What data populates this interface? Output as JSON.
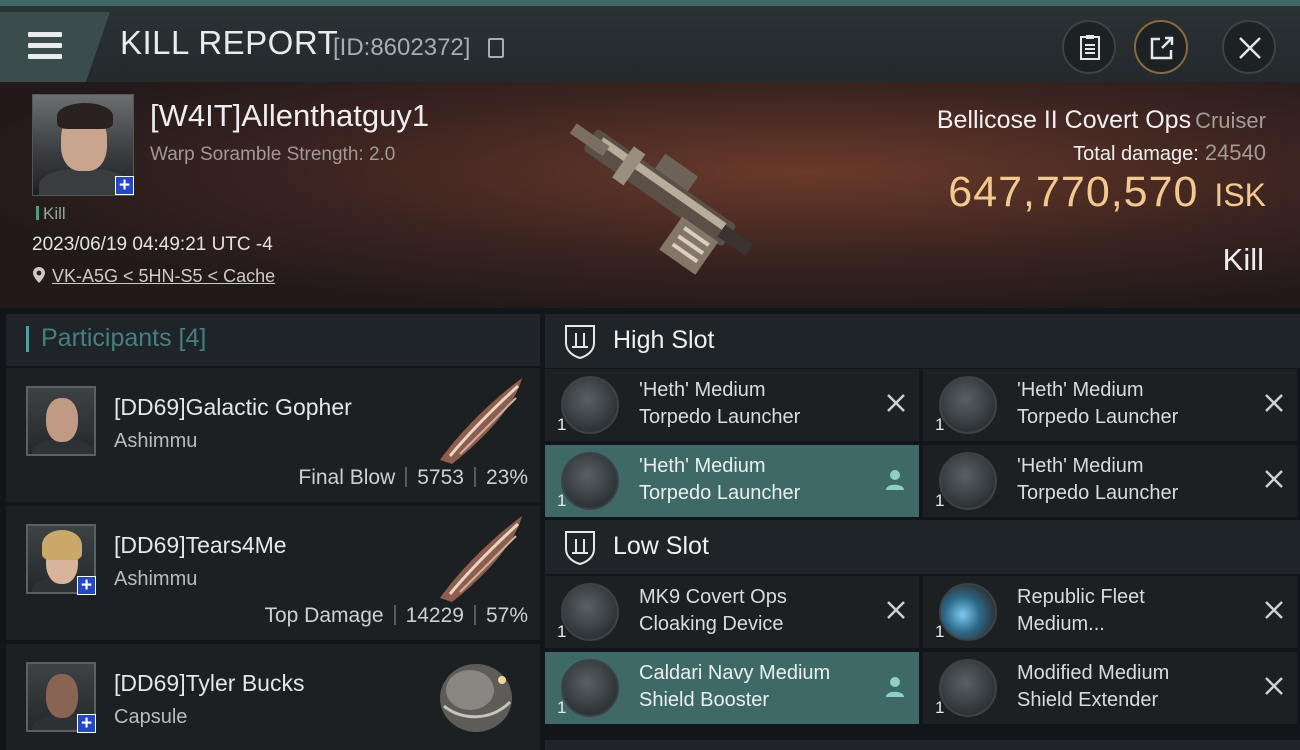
{
  "header": {
    "title": "KILL REPORT",
    "report_id": "[ID:8602372]",
    "icons": [
      "menu-icon",
      "copy-icon",
      "clipboard-icon",
      "share-icon",
      "close-icon"
    ]
  },
  "victim": {
    "name": "[W4IT]Allenthatguy1",
    "scramble": "Warp Soramble Strength: 2.0",
    "tag": "Kill",
    "datetime": "2023/06/19 04:49:21 UTC -4",
    "location": "VK-A5G < 5HN-S5 < Cache",
    "ship": "Bellicose II Covert Ops",
    "ship_class": "Cruiser",
    "total_damage_label": "Total damage:",
    "total_damage": "24540",
    "isk_value": "647,770,570",
    "isk_unit": "ISK",
    "result": "Kill"
  },
  "participants": {
    "header": "Participants [4]",
    "items": [
      {
        "name": "[DD69]Galactic Gopher",
        "ship": "Ashimmu",
        "role": "Final Blow",
        "damage": "5753",
        "percent": "23%"
      },
      {
        "name": "[DD69]Tears4Me",
        "ship": "Ashimmu",
        "role": "Top Damage",
        "damage": "14229",
        "percent": "57%"
      },
      {
        "name": "[DD69]Tyler Bucks",
        "ship": "Capsule"
      }
    ]
  },
  "fitting": {
    "high_slot": {
      "label": "High Slot",
      "modules": [
        {
          "qty": "1",
          "line1": "'Heth' Medium",
          "line2": "Torpedo Launcher"
        },
        {
          "qty": "1",
          "line1": "'Heth' Medium",
          "line2": "Torpedo Launcher"
        },
        {
          "qty": "1",
          "line1": "'Heth' Medium",
          "line2": "Torpedo Launcher"
        },
        {
          "qty": "1",
          "line1": "'Heth' Medium",
          "line2": "Torpedo Launcher"
        }
      ]
    },
    "low_slot": {
      "label": "Low Slot",
      "modules": [
        {
          "qty": "1",
          "line1": "MK9 Covert Ops",
          "line2": "Cloaking Device"
        },
        {
          "qty": "1",
          "line1": "Republic Fleet",
          "line2": "Medium..."
        },
        {
          "qty": "1",
          "line1": "Caldari Navy Medium",
          "line2": "Shield Booster"
        },
        {
          "qty": "1",
          "line1": "Modified Medium",
          "line2": "Shield Extender"
        }
      ]
    }
  },
  "colors": {
    "accent_teal": "#4ea3a0",
    "isk_gold": "#f2c98e",
    "fitted_module": "#3f6967",
    "panel": "#1c2023"
  }
}
